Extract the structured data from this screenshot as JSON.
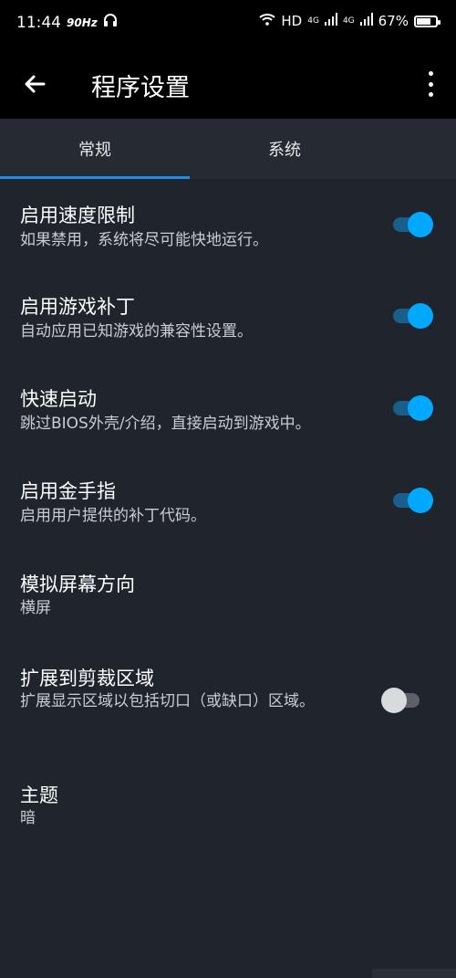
{
  "status_bar": {
    "time": "11:44",
    "refresh": "90Hz",
    "hd": "HD",
    "net1": "4G",
    "net2": "4G",
    "battery": "67%",
    "battery_level": 0.67
  },
  "app_bar": {
    "title": "程序设置"
  },
  "tabs": [
    {
      "label": "常规",
      "selected": true
    },
    {
      "label": "系统",
      "selected": false
    }
  ],
  "settings": [
    {
      "title": "启用速度限制",
      "subtitle": "如果禁用，系统将尽可能快地运行。",
      "toggle": true
    },
    {
      "title": "启用游戏补丁",
      "subtitle": "自动应用已知游戏的兼容性设置。",
      "toggle": true
    },
    {
      "title": "快速启动",
      "subtitle": "跳过BIOS外壳/介绍，直接启动到游戏中。",
      "toggle": true
    },
    {
      "title": "启用金手指",
      "subtitle": "启用用户提供的补丁代码。",
      "toggle": true
    },
    {
      "title": "模拟屏幕方向",
      "subtitle": "横屏"
    },
    {
      "title": "扩展到剪裁区域",
      "subtitle": "扩展显示区域以包括切口（或缺口）区域。",
      "toggle": false
    },
    {
      "title": "主题",
      "subtitle": "暗"
    }
  ],
  "colors": {
    "accent": "#00a8ff",
    "background": "#20252d",
    "app_bar": "#000000"
  }
}
